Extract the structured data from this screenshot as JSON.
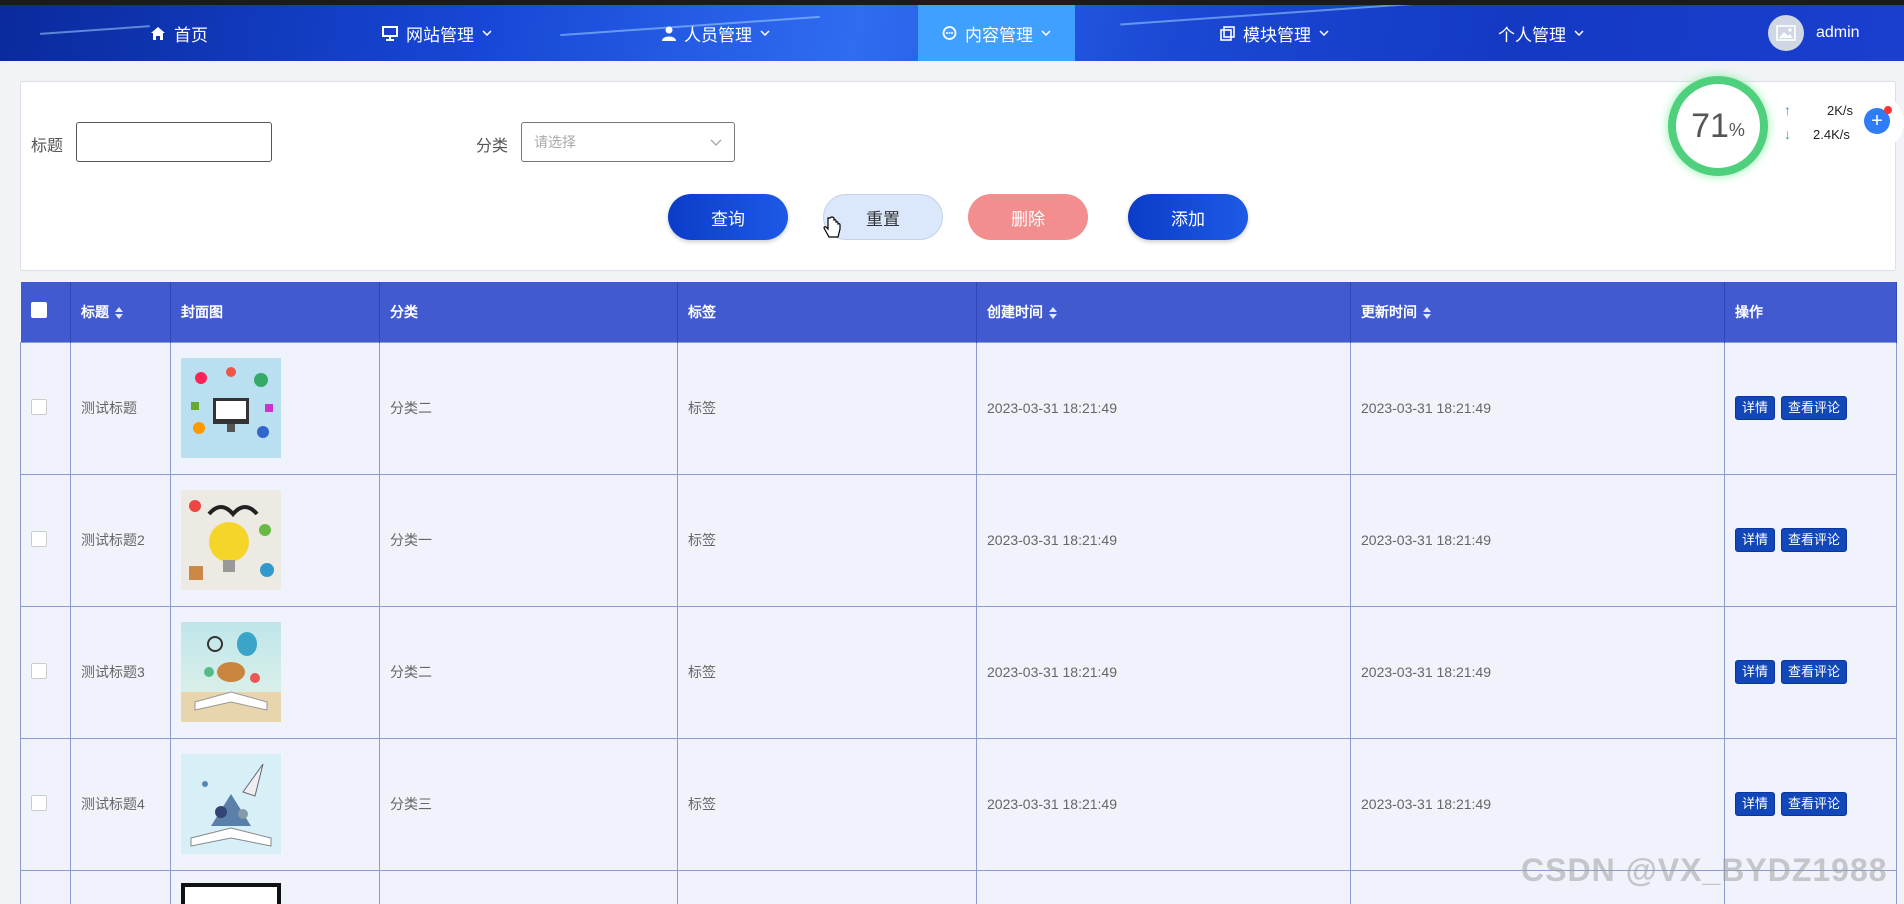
{
  "nav": {
    "items": [
      {
        "label": "首页",
        "icon": "home-icon"
      },
      {
        "label": "网站管理",
        "icon": "monitor-icon"
      },
      {
        "label": "人员管理",
        "icon": "user-icon"
      },
      {
        "label": "内容管理",
        "icon": "chat-icon",
        "active": true
      },
      {
        "label": "模块管理",
        "icon": "copy-icon"
      },
      {
        "label": "个人管理",
        "icon": ""
      }
    ],
    "user": "admin"
  },
  "search": {
    "title_label": "标题",
    "title_value": "",
    "category_label": "分类",
    "category_placeholder": "请选择",
    "buttons": {
      "query": "查询",
      "reset": "重置",
      "delete": "删除",
      "add": "添加"
    }
  },
  "table": {
    "headers": [
      "标题",
      "封面图",
      "分类",
      "标签",
      "创建时间",
      "更新时间",
      "操作"
    ],
    "rows": [
      {
        "title": "测试标题",
        "category": "分类二",
        "tag": "标签",
        "created": "2023-03-31 18:21:49",
        "updated": "2023-03-31 18:21:49"
      },
      {
        "title": "测试标题2",
        "category": "分类一",
        "tag": "标签",
        "created": "2023-03-31 18:21:49",
        "updated": "2023-03-31 18:21:49"
      },
      {
        "title": "测试标题3",
        "category": "分类二",
        "tag": "标签",
        "created": "2023-03-31 18:21:49",
        "updated": "2023-03-31 18:21:49"
      },
      {
        "title": "测试标题4",
        "category": "分类三",
        "tag": "标签",
        "created": "2023-03-31 18:21:49",
        "updated": "2023-03-31 18:21:49"
      }
    ],
    "actions": {
      "detail": "详情",
      "comments": "查看评论"
    }
  },
  "widget": {
    "percent": "71",
    "percent_unit": "%",
    "upload": "2K/s",
    "download": "2.4K/s"
  },
  "watermark": "CSDN @VX_BYDZ1988",
  "colors": {
    "nav": "#1746d6",
    "nav_active": "#3fa0ff",
    "header": "#415ad0",
    "primary_btn": "#0b3cc8",
    "danger_btn": "#f28e8e",
    "action_btn": "#1147b8"
  }
}
